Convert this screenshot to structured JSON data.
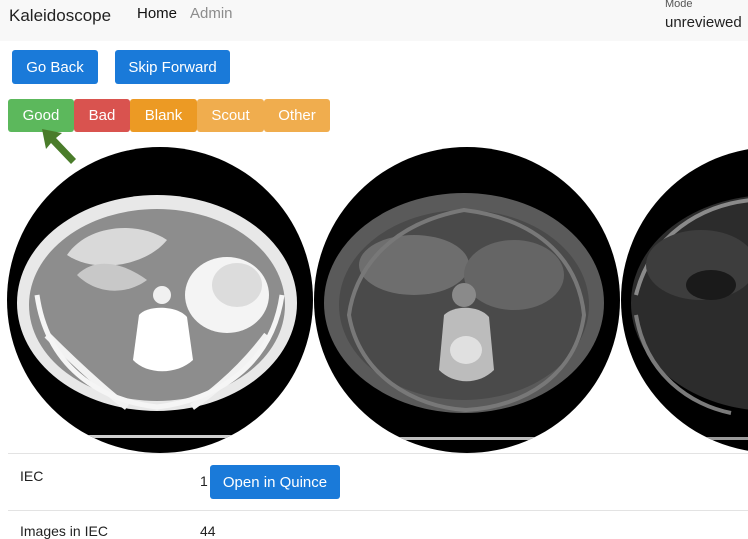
{
  "navbar": {
    "brand": "Kaleidoscope",
    "links": [
      {
        "label": "Home"
      },
      {
        "label": "Admin"
      }
    ],
    "mode": {
      "label": "Mode",
      "value": "unreviewed"
    }
  },
  "controls": {
    "go_back": "Go Back",
    "skip_forward": "Skip Forward"
  },
  "classification": {
    "buttons": [
      {
        "label": "Good",
        "color": "#5cb85c"
      },
      {
        "label": "Bad",
        "color": "#d9534f"
      },
      {
        "label": "Blank",
        "color": "#f0a12b"
      },
      {
        "label": "Scout",
        "color": "#f0ad4e"
      },
      {
        "label": "Other",
        "color": "#f0ad4e"
      }
    ],
    "pointer_color": "#4a7c2a"
  },
  "scans": [
    {
      "icon": "ct-scan-sharp"
    },
    {
      "icon": "ct-scan-blurred"
    },
    {
      "icon": "ct-scan-partial"
    }
  ],
  "details": {
    "iec": {
      "label": "IEC",
      "value": "1",
      "button": "Open in Quince"
    },
    "images": {
      "label": "Images in IEC",
      "value": "44"
    }
  },
  "colors": {
    "primary": "#1a7ad9",
    "navbar_bg": "#f8f8f8"
  }
}
